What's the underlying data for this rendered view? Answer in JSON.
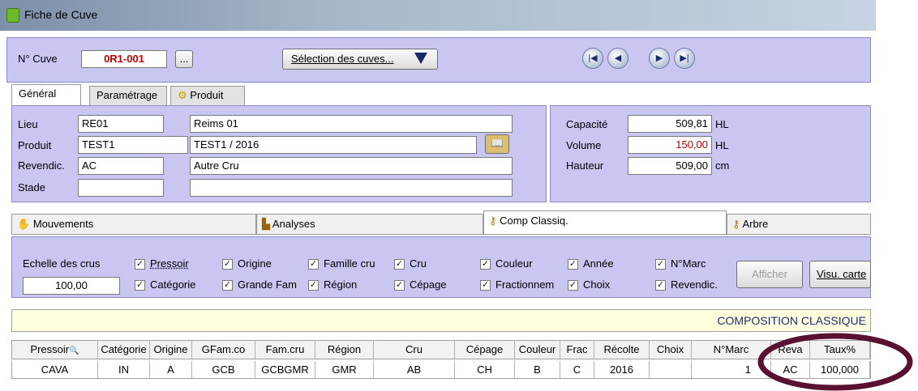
{
  "window": {
    "title": "Fiche de Cuve"
  },
  "top": {
    "cuve_label": "N° Cuve",
    "cuve_value": "0R1-001",
    "ellipsis_label": "...",
    "selection_label": "Sélection des cuves...",
    "nav": [
      "|◀",
      "◀",
      "▶",
      "▶|"
    ]
  },
  "tabs": [
    {
      "label": "Général"
    },
    {
      "label": "Paramétrage"
    },
    {
      "label": "Produit"
    }
  ],
  "general": {
    "lieu_label": "Lieu",
    "lieu_code": "RE01",
    "lieu_name": "Reims 01",
    "produit_label": "Produit",
    "produit_code": "TEST1",
    "produit_name": "TEST1 / 2016",
    "revendic_label": "Revendic.",
    "revendic_code": "AC",
    "revendic_name": "Autre Cru",
    "stade_label": "Stade",
    "stade_code": "",
    "stade_name": ""
  },
  "capacity": {
    "capacite_label": "Capacité",
    "capacite_value": "509,81",
    "capacite_unit": "HL",
    "volume_label": "Volume",
    "volume_value": "150,00",
    "volume_unit": "HL",
    "hauteur_label": "Hauteur",
    "hauteur_value": "509,00",
    "hauteur_unit": "cm"
  },
  "subtabs": [
    "Mouvements",
    "Analyses",
    "Comp Classiq.",
    "Arbre"
  ],
  "comp": {
    "echelle_label": "Echelle des crus",
    "echelle_value": "100,00",
    "checks_row1": [
      "Pressoir",
      "Origine",
      "Famille cru",
      "Cru",
      "Couleur",
      "Année",
      "N°Marc"
    ],
    "checks_row2": [
      "Catégorie",
      "Grande Fam",
      "Région",
      "Cépage",
      "Fractionnem",
      "Choix",
      "Revendic."
    ],
    "afficher_label": "Afficher",
    "visu_label": "Visu. carte",
    "section_title": "COMPOSITION CLASSIQUE"
  },
  "grid": {
    "headers": [
      "Pressoir",
      "Catégorie",
      "Origine",
      "GFam.co",
      "Fam.cru",
      "Région",
      "Cru",
      "Cépage",
      "Couleur",
      "Frac",
      "Récolte",
      "Choix",
      "N°Marc",
      "Reva",
      "Taux%"
    ],
    "row": [
      "CAVA",
      "IN",
      "A",
      "GCB",
      "GCBGMR",
      "GMR",
      "AB",
      "CH",
      "B",
      "C",
      "2016",
      "",
      "1",
      "AC",
      "100,000"
    ]
  }
}
